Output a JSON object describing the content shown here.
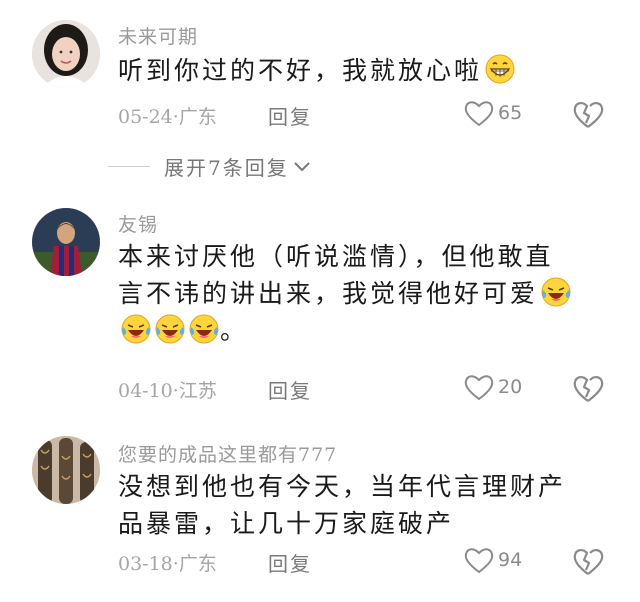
{
  "comments": [
    {
      "username": "未来可期",
      "text_line1": "听到你过的不好，我就放心啦",
      "date": "05-24",
      "location": "广东",
      "reply_label": "回复",
      "likes": "65",
      "emoji": [
        "grin-emoji"
      ]
    },
    {
      "username": "友锡",
      "text_line1": "本来讨厌他（听说滥情），但他敢直",
      "text_line2": "言不讳的讲出来，我觉得他好可爱",
      "text_line3": "。",
      "date": "04-10",
      "location": "江苏",
      "reply_label": "回复",
      "likes": "20",
      "emoji": [
        "laugh-cry-emoji",
        "laugh-cry-emoji",
        "laugh-cry-emoji",
        "laugh-cry-emoji"
      ]
    },
    {
      "username": "您要的成品这里都有777",
      "text_line1": "没想到他也有今天，当年代言理财产",
      "text_line2": "品暴雷，让几十万家庭破产",
      "date": "03-18",
      "location": "广东",
      "reply_label": "回复",
      "likes": "94"
    }
  ],
  "expand_replies": "展开7条回复",
  "separator": "·",
  "colors": {
    "text": "#1a1a1a",
    "meta": "#a5a5a5",
    "username": "#9a9a9a"
  }
}
